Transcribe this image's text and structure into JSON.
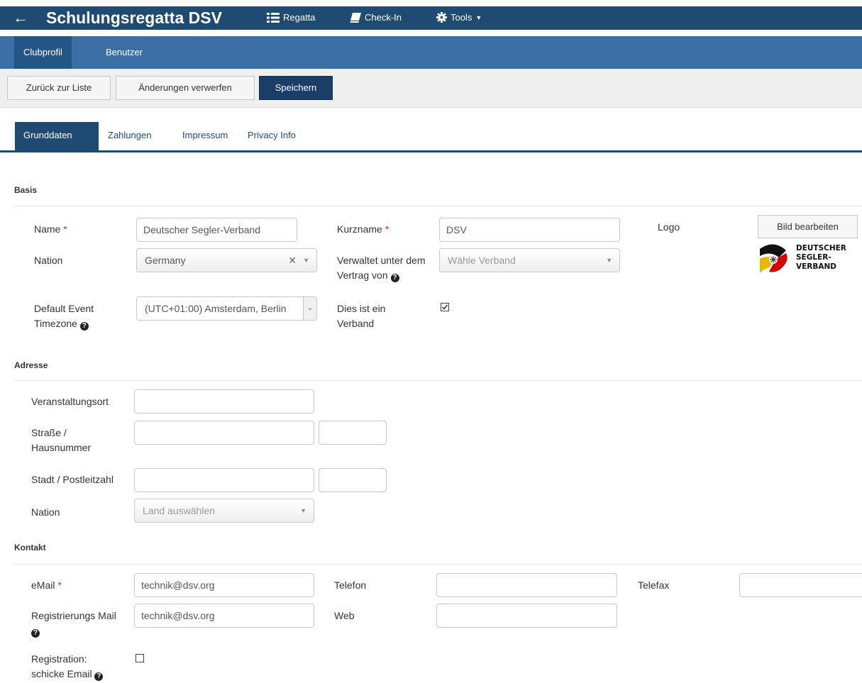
{
  "topbar": {
    "back_icon": "arrow-left-icon",
    "title": "Schulungsregatta DSV",
    "nav": [
      {
        "label": "Regatta",
        "icon": "list-icon"
      },
      {
        "label": "Check-In",
        "icon": "book-icon"
      },
      {
        "label": "Tools",
        "icon": "gear-icon"
      }
    ]
  },
  "subnav": [
    {
      "label": "Clubprofil",
      "active": true
    },
    {
      "label": "Benutzer",
      "active": false
    }
  ],
  "toolbar": {
    "back_label": "Zurück zur Liste",
    "discard_label": "Änderungen verwerfen",
    "save_label": "Speichern"
  },
  "tabs": [
    {
      "label": "Grunddaten",
      "active": true
    },
    {
      "label": "Zahlungen",
      "active": false
    },
    {
      "label": "Impressum",
      "active": false
    },
    {
      "label": "Privacy Info",
      "active": false
    }
  ],
  "basis": {
    "title": "Basis",
    "name_label": "Name",
    "name_value": "Deutscher Segler-Verband",
    "kurzname_label": "Kurzname",
    "kurzname_value": "DSV",
    "logo_label": "Logo",
    "logo_button": "Bild bearbeiten",
    "logo_text_1": "DEUTSCHER",
    "logo_text_2": "SEGLER-",
    "logo_text_3": "VERBAND",
    "nation_label": "Nation",
    "nation_value": "Germany",
    "verwaltet_label_1": "Verwaltet unter dem",
    "verwaltet_label_2": "Vertrag von",
    "verwaltet_placeholder": "Wähle Verband",
    "timezone_label_1": "Default Event",
    "timezone_label_2": "Timezone",
    "timezone_value": "(UTC+01:00) Amsterdam, Berlin",
    "verband_label_1": "Dies ist ein",
    "verband_label_2": "Verband",
    "verband_checked": true
  },
  "adresse": {
    "title": "Adresse",
    "ort_label": "Veranstaltungsort",
    "strasse_label_1": "Straße /",
    "strasse_label_2": "Hausnummer",
    "stadt_label": "Stadt / Postleitzahl",
    "nation_label": "Nation",
    "nation_placeholder": "Land auswählen"
  },
  "kontakt": {
    "title": "Kontakt",
    "email_label": "eMail",
    "email_value": "technik@dsv.org",
    "telefon_label": "Telefon",
    "telefax_label": "Telefax",
    "reg_mail_label": "Registrierungs Mail",
    "reg_mail_value": "technik@dsv.org",
    "web_label": "Web",
    "reg_send_label_1": "Registration:",
    "reg_send_label_2": "schicke Email",
    "reg_send_checked": false
  },
  "colors": {
    "topbar": "#1f4b73",
    "subbar": "#3b6fa5",
    "primary_button": "#1a3e68",
    "required": "#d2322d"
  }
}
